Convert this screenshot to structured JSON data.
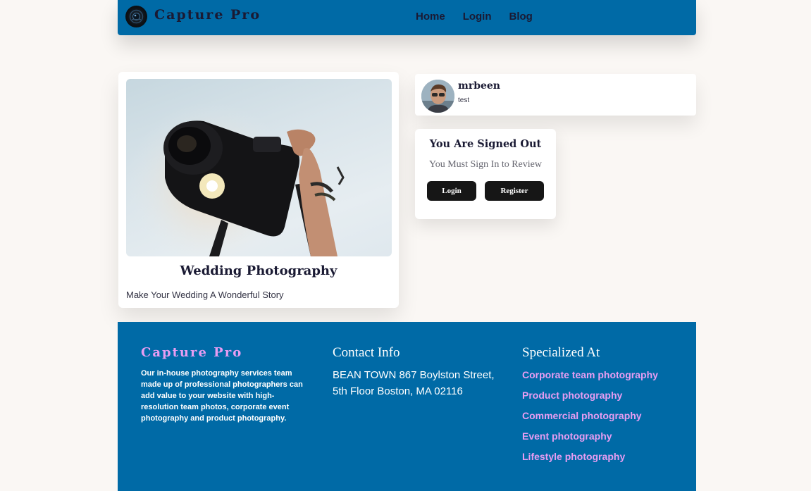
{
  "header": {
    "brand": "Capture Pro",
    "nav": [
      "Home",
      "Login",
      "Blog"
    ],
    "logo_icon": "camera-lens-logo"
  },
  "service_card": {
    "title": "Wedding Photography",
    "description": "Make Your Wedding A Wonderful Story",
    "image": "camera-held-against-sky-photo"
  },
  "profile": {
    "username": "mrbeen",
    "bio": "test",
    "avatar": "user-avatar-photo"
  },
  "auth": {
    "title": "You Are Signed Out",
    "subtitle": "You Must Sign In to Review",
    "login_label": "Login",
    "register_label": "Register"
  },
  "footer": {
    "brand": "Capture Pro",
    "about": "Our in-house photography services team made up of professional photographers can add value to your website with high-resolution team photos, corporate event photography and product photography.",
    "contact_heading": "Contact Info",
    "contact_address": "BEAN TOWN 867 Boylston Street, 5th Floor Boston, MA 02116",
    "specialized_heading": "Specialized At",
    "specialties": [
      "Corporate team photography",
      "Product photography",
      "Commercial photography",
      "Event photography",
      "Lifestyle photography"
    ]
  },
  "colors": {
    "primary": "#006aa6",
    "accent": "#e79df2",
    "page_background": "#faf7f4",
    "button": "#161616"
  }
}
